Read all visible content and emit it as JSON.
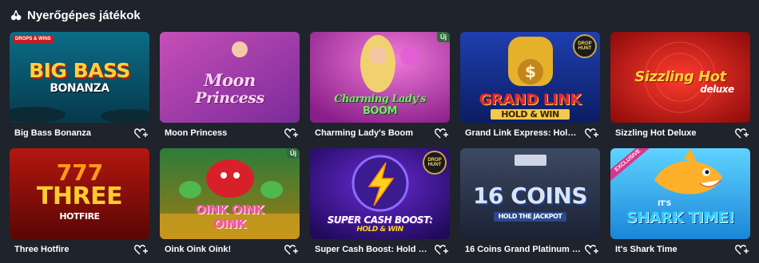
{
  "section": {
    "title": "Nyerőgépes játékok",
    "icon": "cherry-icon"
  },
  "badges": {
    "new": "Új",
    "drop_hunt": "DROP HUNT",
    "drops_wins": "DROPS & WINS",
    "exclusive": "EXCLUSIVE"
  },
  "games": [
    {
      "name": "Big Bass Bonanza",
      "art_line1": "BIG BASS",
      "art_line2": "BONANZA"
    },
    {
      "name": "Moon Princess",
      "art_line1": "Moon",
      "art_line2": "Princess"
    },
    {
      "name": "Charming Lady's Boom",
      "art_line1": "Charming Lady's",
      "art_line2": "BOOM"
    },
    {
      "name": "Grand Link Express: Hold & Win",
      "art_line1": "GRAND LINK",
      "art_line2": "HOLD & WIN"
    },
    {
      "name": "Sizzling Hot Deluxe",
      "art_line1": "Sizzling Hot",
      "art_line2": "deluxe"
    },
    {
      "name": "Three Hotfire",
      "art_line1": "THREE",
      "art_line2": "HOTFIRE"
    },
    {
      "name": "Oink Oink Oink!",
      "art_line1": "OINK OINK",
      "art_line2": "OINK"
    },
    {
      "name": "Super Cash Boost: Hold & Win",
      "art_line1": "SUPER CASH BOOST:",
      "art_line2": "HOLD & WIN"
    },
    {
      "name": "16 Coins Grand Platinum Editi...",
      "art_line1": "16 COINS",
      "art_line2": "HOLD THE JACKPOT"
    },
    {
      "name": "It's Shark Time",
      "art_line1": "SHARK TIME!",
      "art_line2": "IT'S"
    }
  ],
  "colors": {
    "background": "#1f232b",
    "text": "#ffffff",
    "new_badge": "#2f6a3a"
  },
  "icons": {
    "favorite": "heart-plus-icon"
  }
}
